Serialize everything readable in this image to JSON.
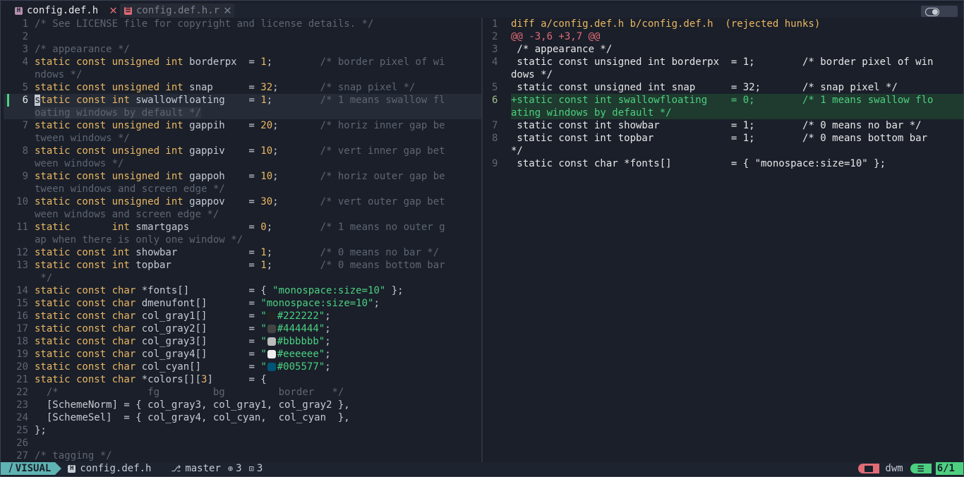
{
  "tabs": [
    {
      "icon": "H",
      "label": "config.def.h"
    },
    {
      "icon": "☰",
      "label": "config.def.h.r"
    }
  ],
  "left_pane": {
    "lines": [
      {
        "n": "1",
        "segs": [
          [
            "cm",
            "/* See LICENSE file for copyright and license details. */"
          ]
        ]
      },
      {
        "n": "2",
        "segs": []
      },
      {
        "n": "3",
        "segs": [
          [
            "cm",
            "/* appearance */"
          ]
        ]
      },
      {
        "n": "4",
        "segs": [
          [
            "kw",
            "static const unsigned int"
          ],
          [
            "plain",
            " borderpx  = "
          ],
          [
            "num",
            "1"
          ],
          [
            "plain",
            ";        "
          ],
          [
            "cm",
            "/* border pixel of wi"
          ]
        ]
      },
      {
        "n": "",
        "segs": [
          [
            "cm",
            "ndows */"
          ]
        ]
      },
      {
        "n": "5",
        "segs": [
          [
            "kw",
            "static const unsigned int"
          ],
          [
            "plain",
            " snap      = "
          ],
          [
            "num",
            "32"
          ],
          [
            "plain",
            ";       "
          ],
          [
            "cm",
            "/* snap pixel */"
          ]
        ]
      },
      {
        "n": "6",
        "cur": true,
        "segs": [
          [
            "cursor",
            "s"
          ],
          [
            "kw",
            "tatic const int"
          ],
          [
            "plain",
            " swallowfloating    = "
          ],
          [
            "num",
            "1"
          ],
          [
            "plain",
            ";        "
          ],
          [
            "cm",
            "/* 1 means swallow fl"
          ]
        ]
      },
      {
        "n": "",
        "curwrap": true,
        "segs": [
          [
            "cm",
            "oating windows by default */"
          ]
        ]
      },
      {
        "n": "7",
        "segs": [
          [
            "kw",
            "static const unsigned int"
          ],
          [
            "plain",
            " gappih    = "
          ],
          [
            "num",
            "20"
          ],
          [
            "plain",
            ";       "
          ],
          [
            "cm",
            "/* horiz inner gap be"
          ]
        ]
      },
      {
        "n": "",
        "segs": [
          [
            "cm",
            "tween windows */"
          ]
        ]
      },
      {
        "n": "8",
        "segs": [
          [
            "kw",
            "static const unsigned int"
          ],
          [
            "plain",
            " gappiv    = "
          ],
          [
            "num",
            "10"
          ],
          [
            "plain",
            ";       "
          ],
          [
            "cm",
            "/* vert inner gap bet"
          ]
        ]
      },
      {
        "n": "",
        "segs": [
          [
            "cm",
            "ween windows */"
          ]
        ]
      },
      {
        "n": "9",
        "segs": [
          [
            "kw",
            "static const unsigned int"
          ],
          [
            "plain",
            " gappoh    = "
          ],
          [
            "num",
            "10"
          ],
          [
            "plain",
            ";       "
          ],
          [
            "cm",
            "/* horiz outer gap be"
          ]
        ]
      },
      {
        "n": "",
        "segs": [
          [
            "cm",
            "tween windows and screen edge */"
          ]
        ]
      },
      {
        "n": "10",
        "segs": [
          [
            "kw",
            "static const unsigned int"
          ],
          [
            "plain",
            " gappov    = "
          ],
          [
            "num",
            "30"
          ],
          [
            "plain",
            ";       "
          ],
          [
            "cm",
            "/* vert outer gap bet"
          ]
        ]
      },
      {
        "n": "",
        "segs": [
          [
            "cm",
            "ween windows and screen edge */"
          ]
        ]
      },
      {
        "n": "11",
        "segs": [
          [
            "kw",
            "static       int"
          ],
          [
            "plain",
            " smartgaps          = "
          ],
          [
            "num",
            "0"
          ],
          [
            "plain",
            ";        "
          ],
          [
            "cm",
            "/* 1 means no outer g"
          ]
        ]
      },
      {
        "n": "",
        "segs": [
          [
            "cm",
            "ap when there is only one window */"
          ]
        ]
      },
      {
        "n": "12",
        "segs": [
          [
            "kw",
            "static const int"
          ],
          [
            "plain",
            " showbar            = "
          ],
          [
            "num",
            "1"
          ],
          [
            "plain",
            ";        "
          ],
          [
            "cm",
            "/* 0 means no bar */"
          ]
        ]
      },
      {
        "n": "13",
        "segs": [
          [
            "kw",
            "static const int"
          ],
          [
            "plain",
            " topbar             = "
          ],
          [
            "num",
            "1"
          ],
          [
            "plain",
            ";        "
          ],
          [
            "cm",
            "/* 0 means bottom bar"
          ]
        ]
      },
      {
        "n": "",
        "segs": [
          [
            "cm",
            " */"
          ]
        ]
      },
      {
        "n": "14",
        "segs": [
          [
            "kw",
            "static const char"
          ],
          [
            "plain",
            " *fonts[]          = { "
          ],
          [
            "str",
            "\"monospace:size=10\""
          ],
          [
            "plain",
            " };"
          ]
        ]
      },
      {
        "n": "15",
        "segs": [
          [
            "kw",
            "static const char"
          ],
          [
            "plain",
            " dmenufont[]       = "
          ],
          [
            "str",
            "\"monospace:size=10\""
          ],
          [
            "plain",
            ";"
          ]
        ]
      },
      {
        "n": "16",
        "segs": [
          [
            "kw",
            "static const char"
          ],
          [
            "plain",
            " col_gray1[]       = "
          ],
          [
            "str",
            "\""
          ],
          [
            "swatch",
            "#222222"
          ],
          [
            "str",
            "#222222\""
          ],
          [
            "plain",
            ";"
          ]
        ]
      },
      {
        "n": "17",
        "segs": [
          [
            "kw",
            "static const char"
          ],
          [
            "plain",
            " col_gray2[]       = "
          ],
          [
            "str",
            "\""
          ],
          [
            "swatch",
            "#444444"
          ],
          [
            "str",
            "#444444\""
          ],
          [
            "plain",
            ";"
          ]
        ]
      },
      {
        "n": "18",
        "segs": [
          [
            "kw",
            "static const char"
          ],
          [
            "plain",
            " col_gray3[]       = "
          ],
          [
            "str",
            "\""
          ],
          [
            "swatch",
            "#bbbbbb"
          ],
          [
            "str",
            "#bbbbbb\""
          ],
          [
            "plain",
            ";"
          ]
        ]
      },
      {
        "n": "19",
        "segs": [
          [
            "kw",
            "static const char"
          ],
          [
            "plain",
            " col_gray4[]       = "
          ],
          [
            "str",
            "\""
          ],
          [
            "swatch",
            "#eeeeee"
          ],
          [
            "str",
            "#eeeeee\""
          ],
          [
            "plain",
            ";"
          ]
        ]
      },
      {
        "n": "20",
        "segs": [
          [
            "kw",
            "static const char"
          ],
          [
            "plain",
            " col_cyan[]        = "
          ],
          [
            "str",
            "\""
          ],
          [
            "swatch",
            "#005577"
          ],
          [
            "str",
            "#005577\""
          ],
          [
            "plain",
            ";"
          ]
        ]
      },
      {
        "n": "21",
        "segs": [
          [
            "kw",
            "static const char"
          ],
          [
            "plain",
            " *colors[]["
          ],
          [
            "num",
            "3"
          ],
          [
            "plain",
            "]      = {"
          ]
        ]
      },
      {
        "n": "22",
        "segs": [
          [
            "plain",
            "  "
          ],
          [
            "cm",
            "/*               fg         bg         border   */"
          ]
        ]
      },
      {
        "n": "23",
        "segs": [
          [
            "plain",
            "  [SchemeNorm] = { col_gray3, col_gray1, col_gray2 },"
          ]
        ]
      },
      {
        "n": "24",
        "segs": [
          [
            "plain",
            "  [SchemeSel]  = { col_gray4, col_cyan,  col_cyan  },"
          ]
        ]
      },
      {
        "n": "25",
        "segs": [
          [
            "plain",
            "};"
          ]
        ]
      },
      {
        "n": "26",
        "segs": []
      },
      {
        "n": "27",
        "segs": [
          [
            "cm",
            "/* tagging */"
          ]
        ]
      }
    ]
  },
  "right_pane": {
    "lines": [
      {
        "n": "1",
        "cls": "diffhead",
        "text": "diff a/config.def.h b/config.def.h  (rejected hunks)"
      },
      {
        "n": "2",
        "cls": "hunk",
        "text": "@@ -3,6 +3,7 @@"
      },
      {
        "n": "3",
        "cls": "ctx",
        "text": " /* appearance */"
      },
      {
        "n": "4",
        "cls": "ctx",
        "text": " static const unsigned int borderpx  = 1;        /* border pixel of win"
      },
      {
        "n": "",
        "cls": "ctx",
        "text": "dows */"
      },
      {
        "n": "5",
        "cls": "ctx",
        "text": " static const unsigned int snap      = 32;       /* snap pixel */"
      },
      {
        "n": "6",
        "cls": "added",
        "text": "+static const int swallowfloating    = 0;        /* 1 means swallow flo"
      },
      {
        "n": "",
        "cls": "added",
        "text": "ating windows by default */"
      },
      {
        "n": "7",
        "cls": "ctx",
        "text": " static const int showbar            = 1;        /* 0 means no bar */"
      },
      {
        "n": "8",
        "cls": "ctx",
        "text": " static const int topbar             = 1;        /* 0 means bottom bar"
      },
      {
        "n": "",
        "cls": "ctx",
        "text": "*/"
      },
      {
        "n": "9",
        "cls": "ctx",
        "text": " static const char *fonts[]          = { \"monospace:size=10\" };"
      }
    ]
  },
  "statusline": {
    "mode": "VISUAL",
    "mode_icon": "⧸",
    "file_icon": "H",
    "file": "config.def.h",
    "branch_icon": "⎇",
    "branch": "master",
    "added_count": "3",
    "modified_count": "3",
    "project": "dwm",
    "position": "6/1"
  },
  "colors": {
    "background": "#1a1f2a",
    "keyword": "#eab863",
    "string": "#4cd080",
    "comment": "#5f6672",
    "hunk": "#e06c75",
    "mode": "#5fb3b3"
  }
}
